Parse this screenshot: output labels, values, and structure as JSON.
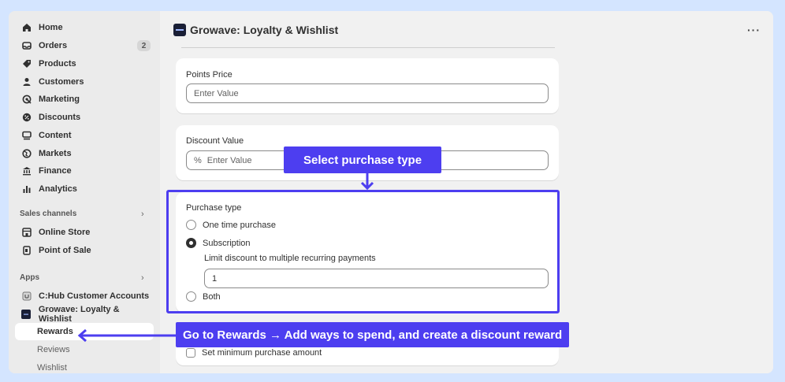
{
  "sidebar": {
    "items": [
      {
        "label": "Home",
        "icon": "home-icon"
      },
      {
        "label": "Orders",
        "icon": "inbox-icon",
        "badge": "2"
      },
      {
        "label": "Products",
        "icon": "tag-icon"
      },
      {
        "label": "Customers",
        "icon": "person-icon"
      },
      {
        "label": "Marketing",
        "icon": "target-icon"
      },
      {
        "label": "Discounts",
        "icon": "discount-icon"
      },
      {
        "label": "Content",
        "icon": "content-icon"
      },
      {
        "label": "Markets",
        "icon": "globe-icon"
      },
      {
        "label": "Finance",
        "icon": "bank-icon"
      },
      {
        "label": "Analytics",
        "icon": "bar-chart-icon"
      }
    ],
    "sales_channels": {
      "title": "Sales channels",
      "items": [
        {
          "label": "Online Store",
          "icon": "store-icon"
        },
        {
          "label": "Point of Sale",
          "icon": "pos-icon"
        }
      ]
    },
    "apps": {
      "title": "Apps",
      "items": [
        {
          "label": "C:Hub Customer Accounts",
          "icon": "chub-icon"
        },
        {
          "label": "Growave: Loyalty & Wishlist",
          "icon": "growave-icon"
        }
      ],
      "sub_items": [
        {
          "label": "Rewards",
          "active": true
        },
        {
          "label": "Reviews",
          "active": false
        },
        {
          "label": "Wishlist",
          "active": false
        }
      ]
    }
  },
  "header": {
    "title": "Growave: Loyalty & Wishlist",
    "more_label": "···"
  },
  "points_price": {
    "label": "Points Price",
    "placeholder": "Enter Value"
  },
  "discount_value": {
    "label": "Discount Value",
    "prefix": "%",
    "placeholder": "Enter Value"
  },
  "purchase_type": {
    "label": "Purchase type",
    "options": [
      {
        "label": "One time purchase",
        "checked": false
      },
      {
        "label": "Subscription",
        "checked": true
      },
      {
        "label": "Both",
        "checked": false
      }
    ],
    "limit_label": "Limit discount to multiple recurring payments",
    "limit_value": "1"
  },
  "minimum_purchase": {
    "label": "Set minimum purchase amount"
  },
  "callouts": {
    "select_purchase_type": "Select purchase type",
    "go_to_rewards": "Go to Rewards → Add ways to spend, and create a discount reward"
  },
  "colors": {
    "accent": "#4d3ef0",
    "page_background": "#d4e5ff"
  }
}
